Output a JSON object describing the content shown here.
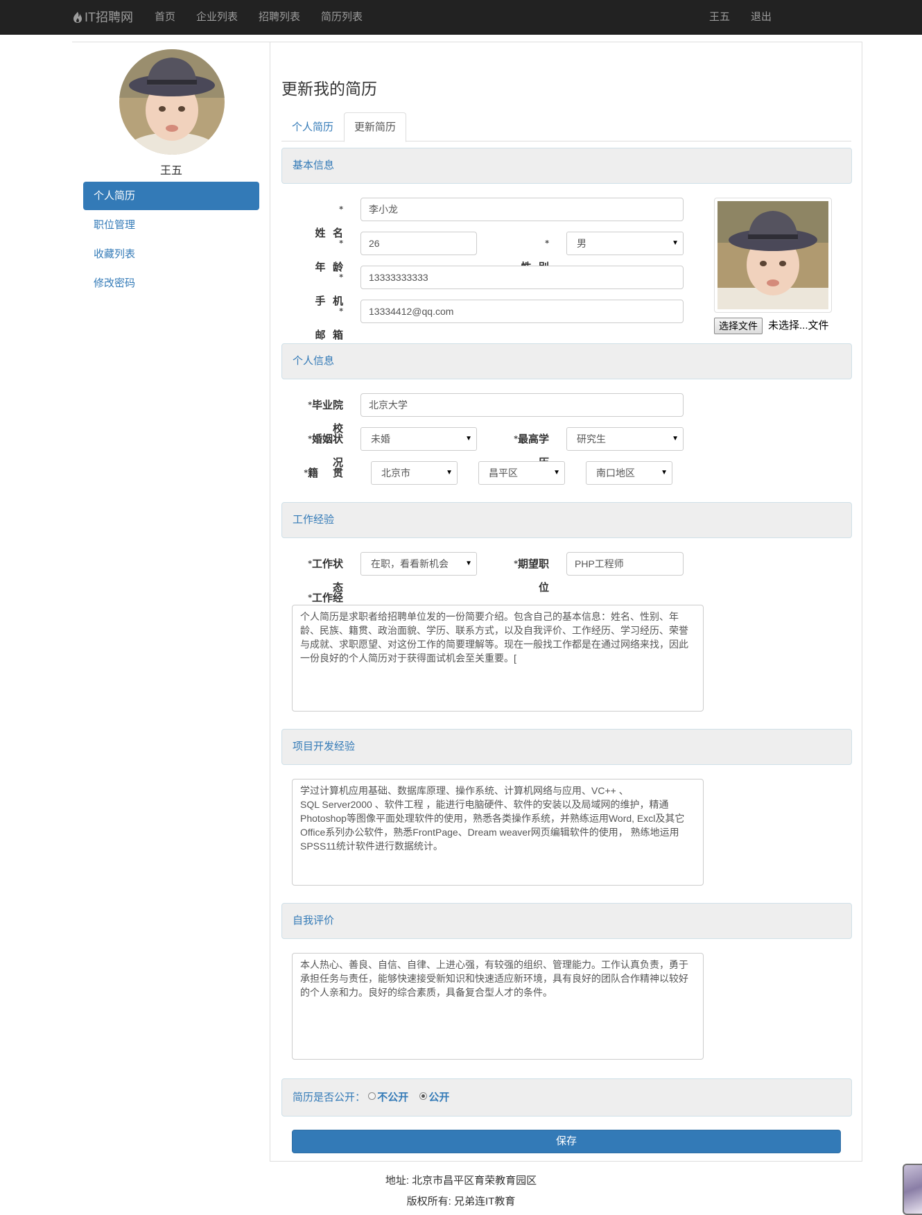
{
  "nav": {
    "brand": "IT招聘网",
    "links": [
      "首页",
      "企业列表",
      "招聘列表",
      "简历列表"
    ],
    "user": "王五",
    "logout": "退出"
  },
  "sidebar": {
    "username": "王五",
    "items": [
      {
        "label": "个人简历",
        "active": true
      },
      {
        "label": "职位管理",
        "active": false
      },
      {
        "label": "收藏列表",
        "active": false
      },
      {
        "label": "修改密码",
        "active": false
      }
    ]
  },
  "page": {
    "title": "更新我的简历",
    "tabs": [
      "个人简历",
      "更新简历"
    ],
    "active_tab": "更新简历"
  },
  "sections": {
    "basic": "基本信息",
    "personal": "个人信息",
    "work": "工作经验",
    "project": "项目开发经验",
    "self": "自我评价"
  },
  "basic": {
    "name_label": "姓  名",
    "name_value": "李小龙",
    "age_label": "年  龄",
    "age_value": "26",
    "gender_label": "性  别",
    "gender_value": "男",
    "phone_label": "手  机",
    "phone_value": "13333333333",
    "email_label": "邮  箱",
    "email_value": "13334412@qq.com",
    "file_button": "选择文件",
    "file_status": "未选择...文件"
  },
  "personal": {
    "school_label": "毕业院校",
    "school_value": "北京大学",
    "marital_label": "婚姻状况",
    "marital_value": "未婚",
    "education_label": "最高学历",
    "education_value": "研究生",
    "origin_label": "籍    贯",
    "city": "北京市",
    "district": "昌平区",
    "area": "南口地区"
  },
  "work": {
    "status_label": "工作状态",
    "status_value": "在职，看看新机会",
    "position_label": "期望职位",
    "position_value": "PHP工程师",
    "experience_label": "工作经历",
    "experience_text": "个人简历是求职者给招聘单位发的一份简要介绍。包含自己的基本信息：姓名、性别、年龄、民族、籍贯、政治面貌、学历、联系方式，以及自我评价、工作经历、学习经历、荣誉与成就、求职愿望、对这份工作的简要理解等。现在一般找工作都是在通过网络来找，因此一份良好的个人简历对于获得面试机会至关重要。["
  },
  "project": {
    "text": "学过计算机应用基础、数据库原理、操作系统、计算机网络与应用、VC++ 、\nSQL Server2000 、软件工程 ，能进行电脑硬件、软件的安装以及局域网的维护，精通Photoshop等图像平面处理软件的使用，熟悉各类操作系统，并熟练运用Word, Excl及其它Office系列办公软件，熟悉FrontPage、Dream weaver网页编辑软件的使用， 熟练地运用SPSS11统计软件进行数据统计。"
  },
  "self": {
    "text": "本人热心、善良、自信、自律、上进心强，有较强的组织、管理能力。工作认真负责，勇于承担任务与责任，能够快速接受新知识和快速适应新环境，具有良好的团队合作精神以较好的个人亲和力。良好的综合素质，具备复合型人才的条件。"
  },
  "public": {
    "label": "简历是否公开：",
    "option_private": "不公开",
    "option_public": "公开",
    "selected": "公开"
  },
  "save_label": "保存",
  "footer": {
    "address": "地址: 北京市昌平区育荣教育园区",
    "copyright": "版权所有: 兄弟连IT教育"
  },
  "colors": {
    "primary": "#337ab7",
    "navbar": "#222222",
    "section_bg": "#eeeeee"
  }
}
